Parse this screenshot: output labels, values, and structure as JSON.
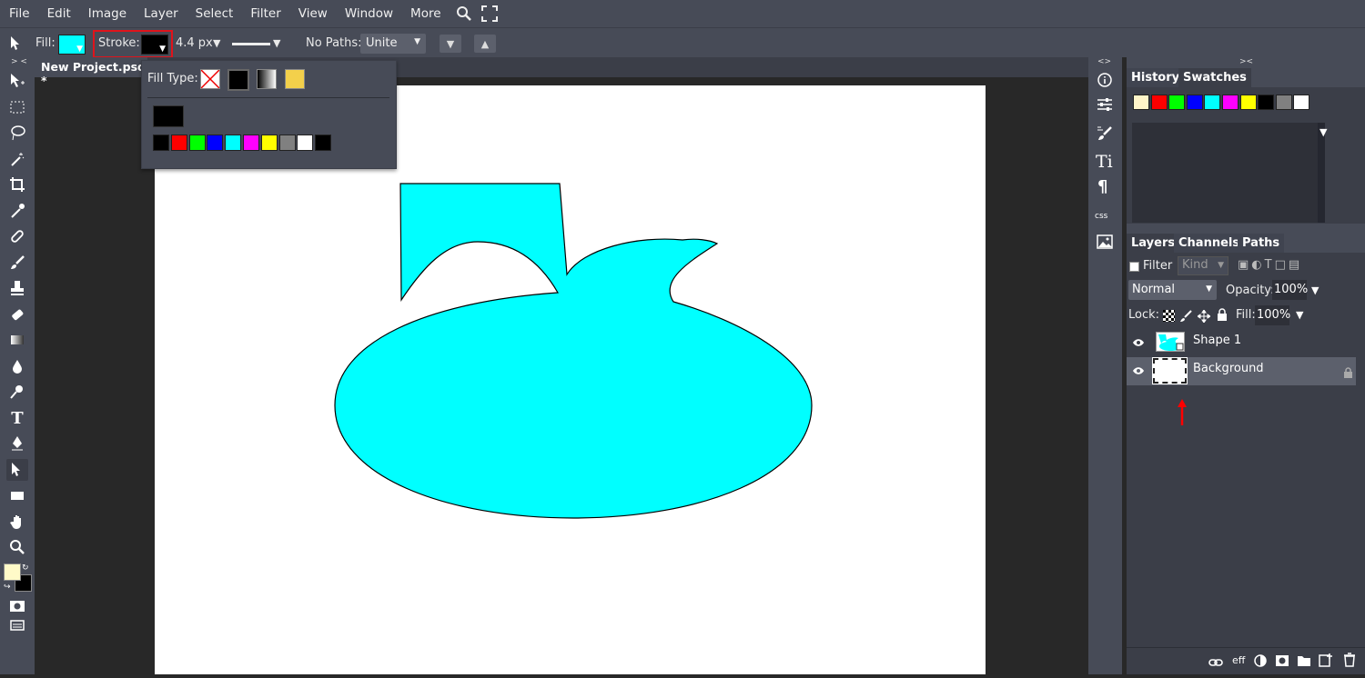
{
  "menu": {
    "items": [
      "File",
      "Edit",
      "Image",
      "Layer",
      "Select",
      "Filter",
      "View",
      "Window",
      "More"
    ]
  },
  "options": {
    "fill_label": "Fill:",
    "fill_color": "#00ffff",
    "stroke_label": "Stroke:",
    "stroke_color": "#000000",
    "stroke_width": "4.4 px",
    "paths_label": "No Paths:",
    "paths_mode": "Unite"
  },
  "document": {
    "tab_title": "New Project.psd *"
  },
  "fill_popup": {
    "fill_type_label": "Fill Type:",
    "current_color": "#000000",
    "palette": [
      "#000000",
      "#ff0000",
      "#00ff00",
      "#0000ff",
      "#00ffff",
      "#ff00ff",
      "#ffff00",
      "#808080",
      "#ffffff",
      "#000000"
    ]
  },
  "shape": {
    "fill": "#00ffff",
    "stroke": "#000000"
  },
  "colors": {
    "foreground": "#fffac8",
    "background": "#000000",
    "annotation": "#ff0000",
    "ui_bg": "#474b57"
  },
  "panels": {
    "top_tabs": [
      "History",
      "Swatches"
    ],
    "swatches": [
      "#fff5c8",
      "#ff0000",
      "#00ff00",
      "#0000ff",
      "#00ffff",
      "#ff00ff",
      "#ffff00",
      "#000000",
      "#808080",
      "#ffffff"
    ],
    "layer_tabs": [
      "Layers",
      "Channels",
      "Paths"
    ],
    "filter_label": "Filter",
    "kind_label": "Kind",
    "blend_mode": "Normal",
    "opacity_label": "Opacity:",
    "opacity_value": "100%",
    "lock_label": "Lock:",
    "fill_label": "Fill:",
    "fill_value": "100%",
    "layers": [
      {
        "name": "Shape 1",
        "selected": false
      },
      {
        "name": "Background",
        "selected": true
      }
    ],
    "footer_eff": "eff"
  },
  "icons": [
    "search-icon",
    "fullscreen-icon",
    "move-icon",
    "marquee-icon",
    "lasso-icon",
    "magic-wand-icon",
    "crop-icon",
    "eyedropper-icon",
    "healing-icon",
    "brush-icon",
    "stamp-icon",
    "eraser-icon",
    "gradient-icon",
    "blur-icon",
    "dodge-icon",
    "type-icon",
    "pen-icon",
    "path-select-icon",
    "rectangle-icon",
    "hand-icon",
    "zoom-icon",
    "info-icon",
    "adjust-icon",
    "brush-settings-icon",
    "character-icon",
    "paragraph-icon",
    "css-icon",
    "image-icon",
    "link-icon",
    "new-layer-icon",
    "folder-icon",
    "trash-icon"
  ]
}
